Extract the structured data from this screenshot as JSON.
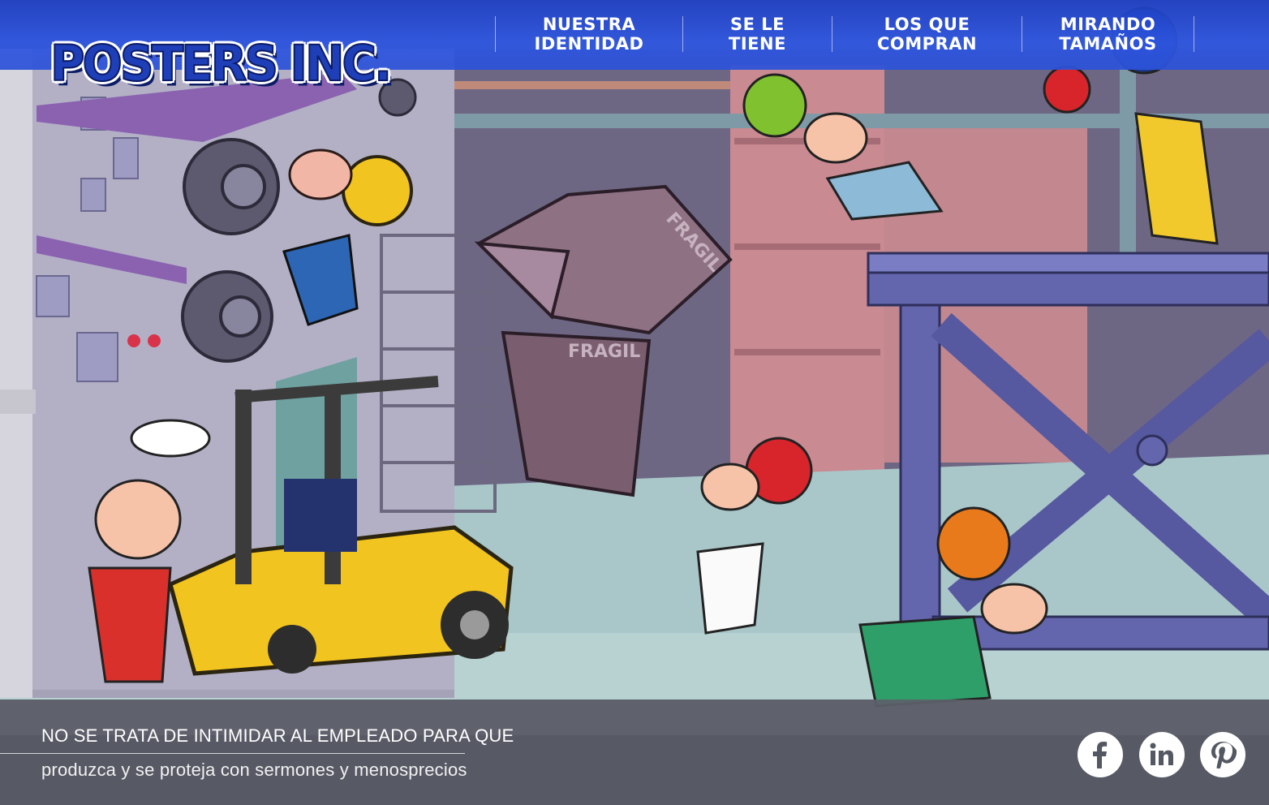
{
  "brand": {
    "logo_text": "POSTERS INC."
  },
  "nav": {
    "items": [
      {
        "label": "NUESTRA\nIDENTIDAD"
      },
      {
        "label": "SE LE\nTIENE"
      },
      {
        "label": "LOS QUE\nCOMPRAN"
      },
      {
        "label": "MIRANDO\nTAMAÑOS"
      }
    ]
  },
  "scene": {
    "box_label_1": "FRAGIL",
    "box_label_2": "FRAGIL"
  },
  "footer": {
    "tagline_line1": "NO SE TRATA DE INTIMIDAR AL EMPLEADO PARA QUE",
    "tagline_line2": "produzca y se proteja con sermones y menosprecios"
  },
  "social": [
    {
      "icon": "facebook-icon"
    },
    {
      "icon": "linkedin-icon"
    },
    {
      "icon": "pinterest-icon"
    }
  ],
  "colors": {
    "nav_bar": "#2d55e0",
    "footer_band": "#545862",
    "text": "#ffffff"
  }
}
